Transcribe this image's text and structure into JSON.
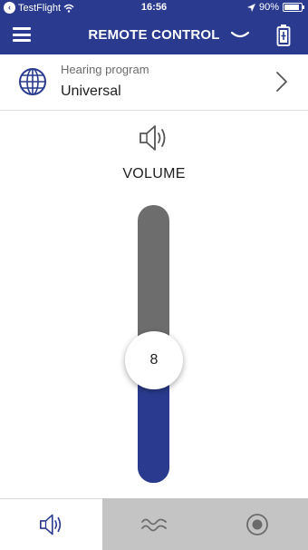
{
  "status_bar": {
    "back_app": "TestFlight",
    "time": "16:56",
    "battery_percent": "90%"
  },
  "nav": {
    "title": "REMOTE CONTROL",
    "menu_icon": "hamburger-menu-icon",
    "chevron_icon": "chevron-down-icon",
    "battery_icon": "hearing-aid-battery-icon"
  },
  "program": {
    "label": "Hearing program",
    "value": "Universal",
    "icon": "globe-icon"
  },
  "volume": {
    "label": "VOLUME",
    "value": "8",
    "level_fraction": 0.44,
    "icon": "speaker-icon"
  },
  "tabs": [
    {
      "icon": "speaker-icon",
      "active": true
    },
    {
      "icon": "waves-icon",
      "active": false
    },
    {
      "icon": "target-icon",
      "active": false
    }
  ],
  "colors": {
    "primary": "#2a3b8f",
    "track": "#6d6d6d",
    "tab_inactive": "#c4c4c4"
  }
}
